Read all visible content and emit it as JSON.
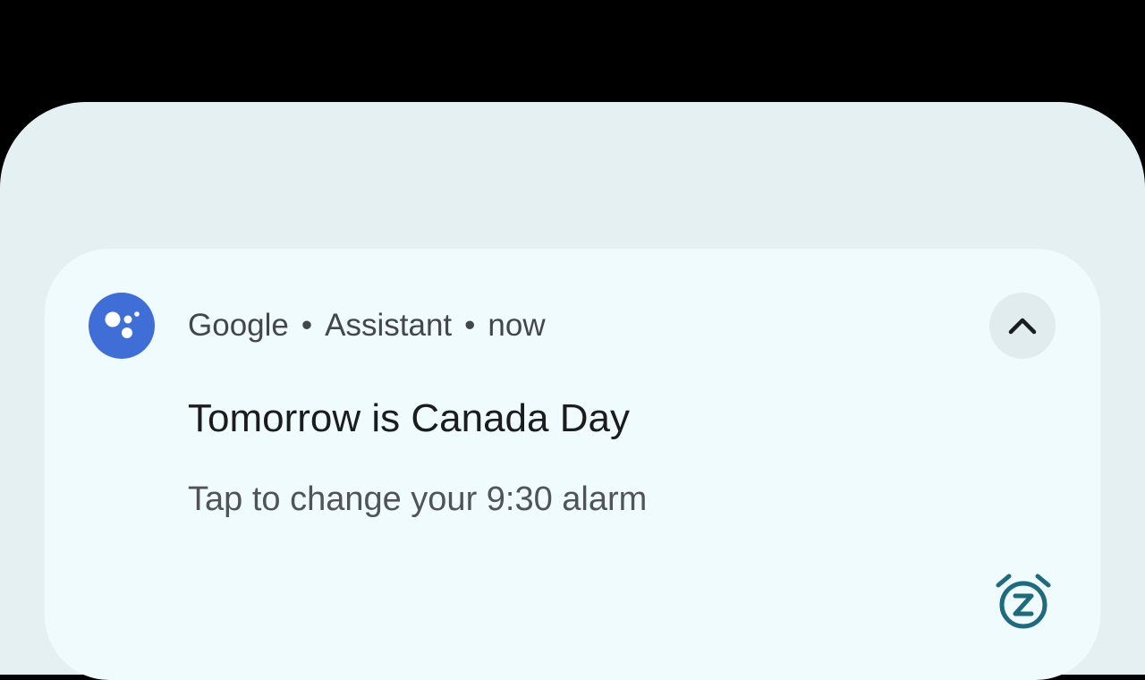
{
  "notification": {
    "app_name": "Google",
    "sub_text": "Assistant",
    "time": "now",
    "separator": "•",
    "title": "Tomorrow is Canada Day",
    "body": "Tap to change your 9:30 alarm"
  },
  "icons": {
    "app": "google-assistant-icon",
    "expand": "chevron-up-icon",
    "action": "alarm-snooze-icon"
  },
  "colors": {
    "assistant_blue": "#3f6fd6",
    "snooze_teal": "#1f6a7c",
    "card_background": "#effbfd",
    "shade_background": "#e5f0f2"
  }
}
